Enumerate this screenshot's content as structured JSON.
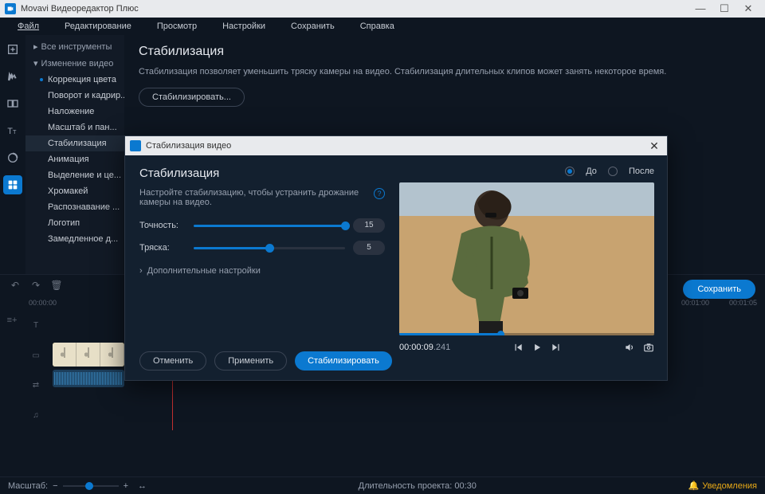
{
  "titlebar": {
    "app_name": "Movavi Видеоредактор Плюс"
  },
  "menu": [
    "Файл",
    "Редактирование",
    "Просмотр",
    "Настройки",
    "Сохранить",
    "Справка"
  ],
  "sidebar": {
    "header": "Все инструменты",
    "section": "Изменение видео",
    "items": [
      {
        "label": "Коррекция цвета",
        "dot": true
      },
      {
        "label": "Поворот и кадрир...",
        "dot": false
      },
      {
        "label": "Наложение",
        "dot": false
      },
      {
        "label": "Масштаб и пан...",
        "dot": false
      },
      {
        "label": "Стабилизация",
        "dot": false,
        "active": true
      },
      {
        "label": "Анимация",
        "dot": false
      },
      {
        "label": "Выделение и це...",
        "dot": false
      },
      {
        "label": "Хромакей",
        "dot": false
      },
      {
        "label": "Распознавание ...",
        "dot": false
      },
      {
        "label": "Логотип",
        "dot": false
      },
      {
        "label": "Замедленное д...",
        "dot": false
      }
    ]
  },
  "content_panel": {
    "heading": "Стабилизация",
    "description": "Стабилизация позволяет уменьшить тряску камеры на видео. Стабилизация длительных клипов может занять некоторое время.",
    "button": "Стабилизировать..."
  },
  "ruler": {
    "start": "00:00:00",
    "end1": "00:01:00",
    "end2": "00:01:05"
  },
  "save_button": "Сохранить",
  "statusbar": {
    "zoom_label": "Масштаб:",
    "duration": "Длительность проекта:  00:30",
    "notifications": "Уведомления"
  },
  "modal": {
    "title": "Стабилизация видео",
    "heading": "Стабилизация",
    "description": "Настройте стабилизацию, чтобы устранить дрожание камеры на видео.",
    "accuracy_label": "Точность:",
    "accuracy_value": "15",
    "accuracy_pct": 100,
    "shake_label": "Тряска:",
    "shake_value": "5",
    "shake_pct": 50,
    "advanced": "Дополнительные настройки",
    "cancel": "Отменить",
    "apply": "Применить",
    "stabilize": "Стабилизировать",
    "before": "До",
    "after": "После",
    "time_main": "00:00:09",
    "time_frac": ".241"
  }
}
